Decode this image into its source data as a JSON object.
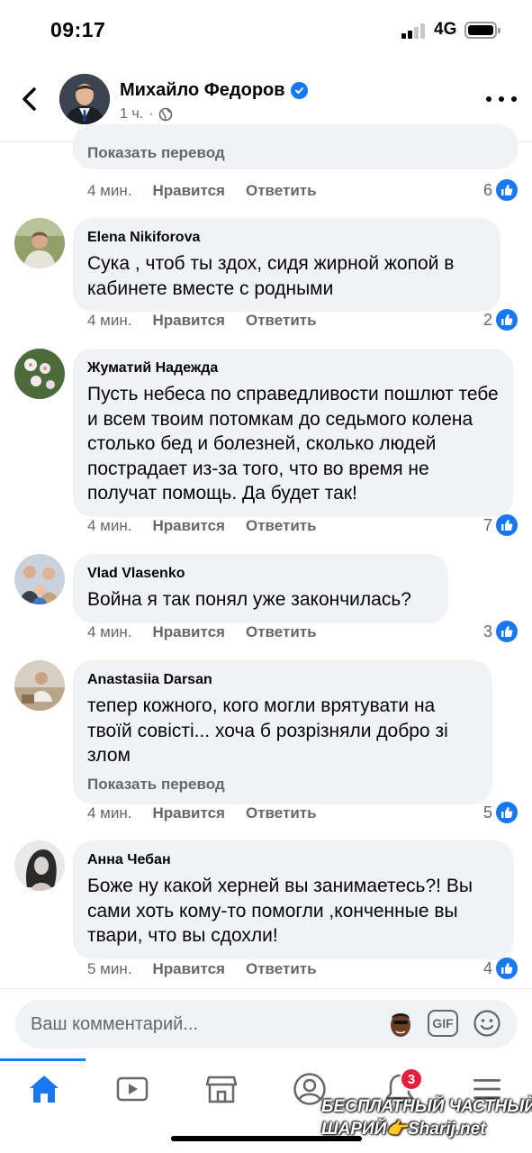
{
  "status": {
    "time": "09:17",
    "network": "4G"
  },
  "header": {
    "name": "Михайло Федоров",
    "time": "1 ч.",
    "separator": "·"
  },
  "actions": {
    "like": "Нравится",
    "reply": "Ответить"
  },
  "top_partial": {
    "translate": "Показать перевод",
    "time": "4 мин.",
    "likes": "6"
  },
  "comments": [
    {
      "author": "Elena Nikiforova",
      "text": "Сука , чтоб ты здох, сидя жирной жопой в кабинете  вместе с родными",
      "time": "4 мин.",
      "likes": "2"
    },
    {
      "author": "Жуматий Надежда",
      "text": "Пусть небеса по справедливости пошлют тебе и всем твоим потомкам до седьмого колена столько бед и болезней, сколько людей пострадает из-за того, что во время не получат помощь. Да будет так!",
      "time": "4 мин.",
      "likes": "7"
    },
    {
      "author": "Vlad Vlasenko",
      "text": "Война я так понял уже закончилась?",
      "time": "4 мин.",
      "likes": "3"
    },
    {
      "author": "Anastasiia Darsan",
      "text": "тепер кожного, кого могли врятувати на твоїй совісті... хоча б розрізняли добро зі злом",
      "translate": "Показать перевод",
      "time": "4 мин.",
      "likes": "5"
    },
    {
      "author": "Анна Чебан",
      "text": "Боже ну какой херней вы занимаетесь?! Вы сами хоть кому-то помогли ,конченные вы твари, что вы сдохли!",
      "time": "5 мин.",
      "likes": "4"
    }
  ],
  "composer": {
    "placeholder": "Ваш комментарий...",
    "gif_label": "GIF"
  },
  "nav": {
    "notifications_count": "3"
  },
  "watermark": {
    "line1": "БЕСПЛАТНЫЙ ЧАСТНЫЙ",
    "line2": "ШАРИЙ👉Sharij.net"
  },
  "icons": [
    "back-arrow-icon",
    "verified-badge-icon",
    "globe-icon",
    "more-icon",
    "like-icon",
    "gif-icon",
    "smile-icon",
    "home-icon",
    "video-icon",
    "marketplace-icon",
    "profile-icon",
    "bell-icon",
    "menu-icon"
  ],
  "colors": {
    "accent": "#1877f2",
    "bubble": "#f0f2f5",
    "muted": "#65676b",
    "badge": "#e41e3f"
  }
}
